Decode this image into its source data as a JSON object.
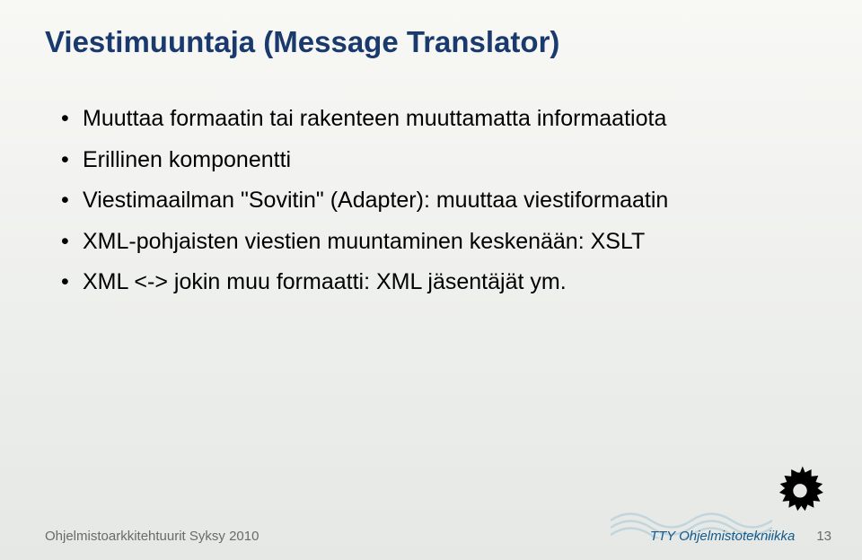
{
  "title": "Viestimuuntaja (Message Translator)",
  "bullets": [
    "Muuttaa formaatin tai rakenteen muuttamatta informaatiota",
    "Erillinen komponentti",
    "Viestimaailman \"Sovitin\" (Adapter): muuttaa viestiformaatin",
    "XML-pohjaisten viestien muuntaminen keskenään: XSLT",
    "XML <-> jokin muu formaatti: XML jäsentäjät ym."
  ],
  "footer": {
    "left": "Ohjelmistoarkkitehtuurit Syksy 2010",
    "right": "TTY Ohjelmistotekniikka",
    "page": "13"
  }
}
